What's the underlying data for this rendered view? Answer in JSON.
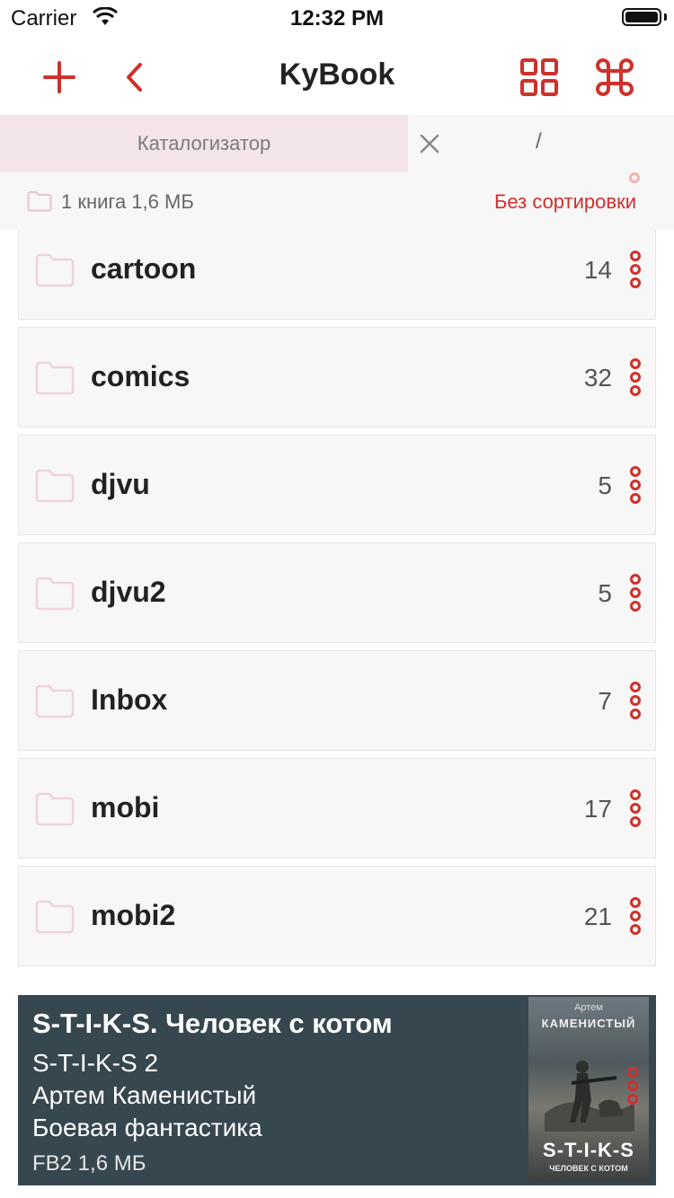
{
  "status": {
    "carrier": "Carrier",
    "time": "12:32 PM"
  },
  "nav": {
    "title": "KyBook",
    "add_icon": "plus-icon",
    "back_icon": "chevron-left-icon",
    "grid_icon": "grid-icon",
    "command_icon": "command-icon"
  },
  "tabs": {
    "active_label": "Каталогизатор",
    "path": "/"
  },
  "info": {
    "count_text": "1 книга 1,6 МБ",
    "sort_label": "Без сортировки"
  },
  "folders": [
    {
      "name": "cartoon",
      "count": "14"
    },
    {
      "name": "comics",
      "count": "32"
    },
    {
      "name": "djvu",
      "count": "5"
    },
    {
      "name": "djvu2",
      "count": "5"
    },
    {
      "name": "Inbox",
      "count": "7"
    },
    {
      "name": "mobi",
      "count": "17"
    },
    {
      "name": "mobi2",
      "count": "21"
    }
  ],
  "book": {
    "title": "S-T-I-K-S. Человек с котом",
    "series": "S-T-I-K-S 2",
    "author": "Артем Каменистый",
    "genre": "Боевая фантастика",
    "meta": "FB2 1,6 МБ",
    "cover": {
      "author": "Артем",
      "author_surname": "КАМЕНИСТЫЙ",
      "series": "S-T-I-K-S",
      "subtitle": "ЧЕЛОВЕК С КОТОМ"
    }
  },
  "colors": {
    "accent": "#d0302b",
    "tab_active_bg": "#f3e4e8",
    "row_bg": "#f7f7f7",
    "card_bg": "#37474f"
  }
}
